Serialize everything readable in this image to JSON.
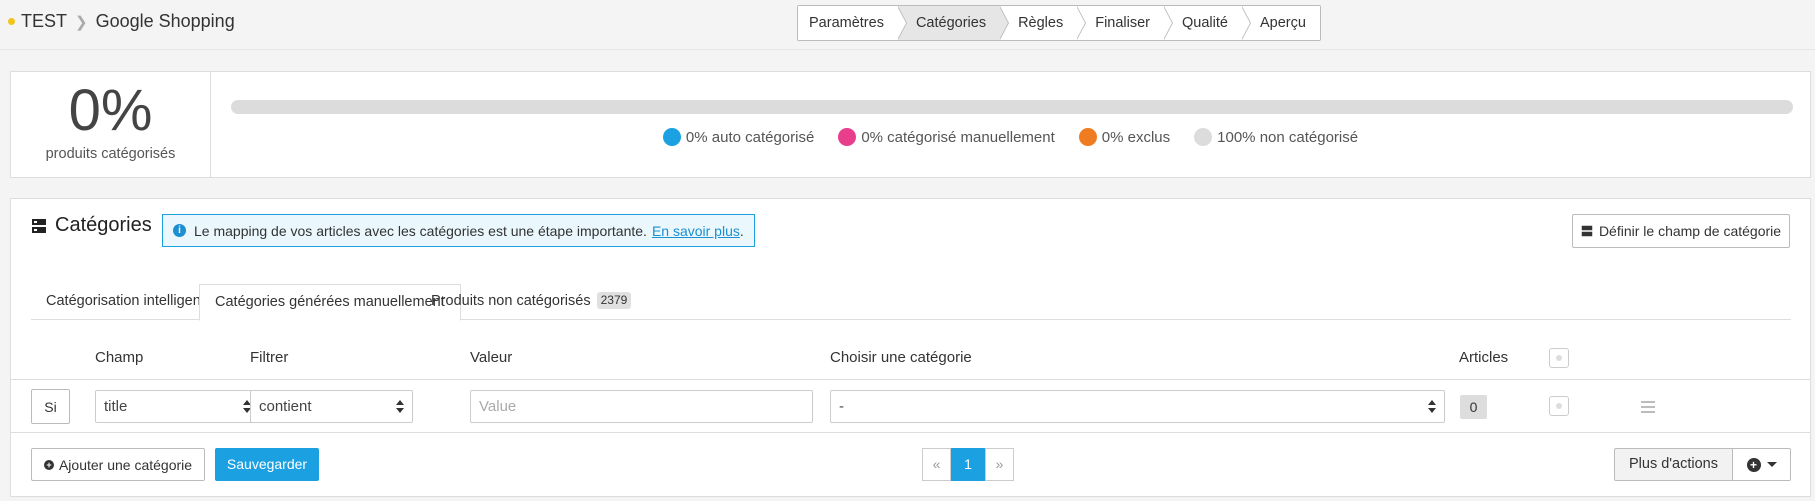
{
  "breadcrumb": {
    "root": "TEST",
    "current": "Google Shopping"
  },
  "steps": [
    "Paramètres",
    "Catégories",
    "Règles",
    "Finaliser",
    "Qualité",
    "Aperçu"
  ],
  "stats": {
    "percent": "0%",
    "label": "produits catégorisés",
    "progress_fraction": 0,
    "legend": [
      {
        "text": "0% auto catégorisé",
        "color": "#1ba1e2"
      },
      {
        "text": "0% catégorisé manuellement",
        "color": "#e83e8c"
      },
      {
        "text": "0% exclus",
        "color": "#f07c22"
      },
      {
        "text": "100% non catégorisé",
        "color": "#dcdcdc"
      }
    ]
  },
  "categories": {
    "title": "Catégories",
    "info_text": "Le mapping de vos articles avec les catégories est une étape importante.",
    "info_link": "En savoir plus",
    "info_end": ".",
    "define_button": "Définir le champ de catégorie",
    "tabs": {
      "smart": "Catégorisation intelligente",
      "manual": "Catégories générées manuellement",
      "uncategorized": "Produits non catégorisés",
      "uncategorized_count": "2379"
    },
    "columns": {
      "champ": "Champ",
      "filtrer": "Filtrer",
      "valeur": "Valeur",
      "categorie": "Choisir une catégorie",
      "articles": "Articles"
    },
    "row": {
      "si": "Si",
      "champ": "title",
      "filtre": "contient",
      "valeur_placeholder": "Value",
      "categorie": "-",
      "articles": "0"
    },
    "add_button": "Ajouter une catégorie",
    "save_button": "Sauvegarder",
    "pager": {
      "prev": "«",
      "current": "1",
      "next": "»"
    },
    "more_actions": "Plus d'actions"
  }
}
